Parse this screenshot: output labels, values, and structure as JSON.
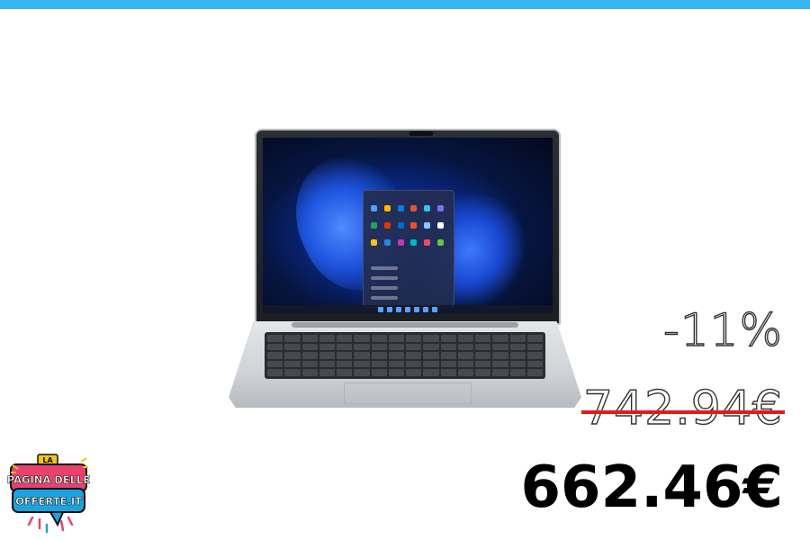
{
  "product": {
    "image_icon": "laptop-image"
  },
  "pricing": {
    "discount": "-11%",
    "old_price": "742.94€",
    "new_price": "662.46€",
    "strike_color": "#e01b1b"
  },
  "logo": {
    "top": "LA",
    "middle": "PAGINA DELLE",
    "bottom": "OFFERTE.IT"
  },
  "colors": {
    "top_bar": "#33b6f2",
    "logo_pink": "#e8416e",
    "logo_blue": "#1aa3e0"
  }
}
